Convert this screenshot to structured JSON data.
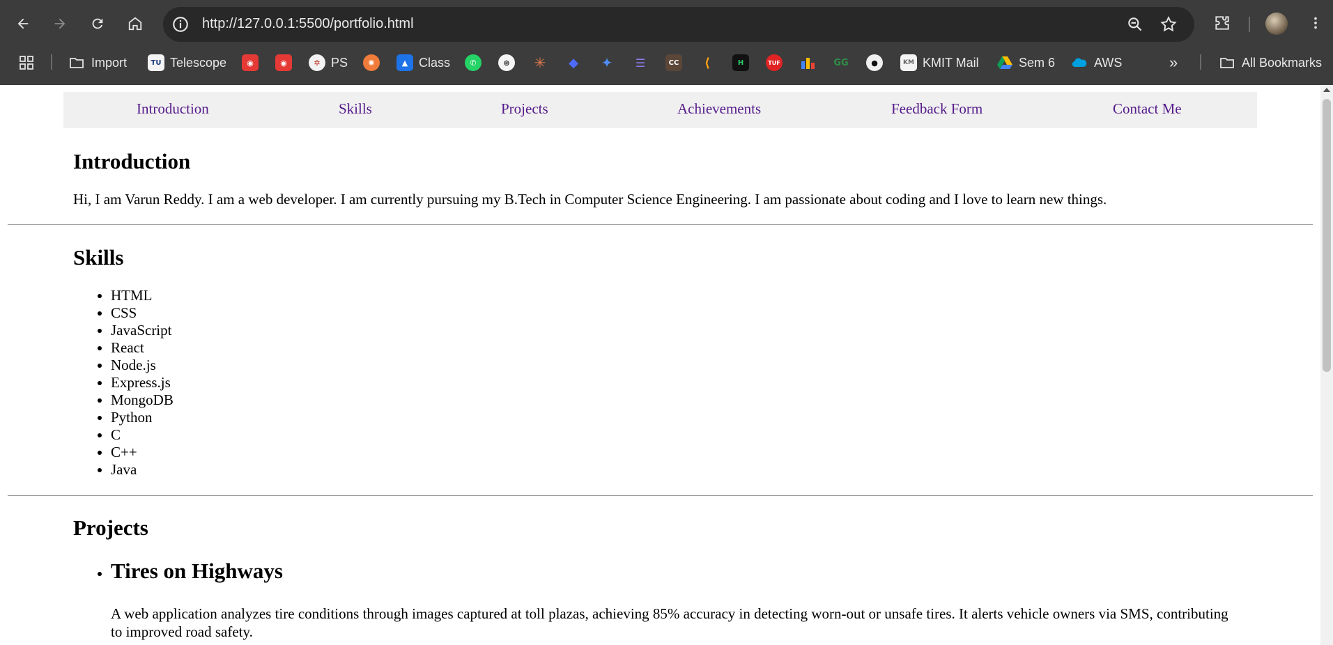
{
  "browser": {
    "url": "http://127.0.0.1:5500/portfolio.html",
    "bookmarks": [
      {
        "label": "Import",
        "icon": "folder-icon"
      },
      {
        "label": "Telescope",
        "icon": "telescope-icon"
      },
      {
        "label": "",
        "icon": "red-eye-icon"
      },
      {
        "label": "",
        "icon": "red-eye-icon"
      },
      {
        "label": "PS",
        "icon": "ps-icon"
      },
      {
        "label": "",
        "icon": "orange-brain-icon"
      },
      {
        "label": "Class",
        "icon": "classroom-icon"
      },
      {
        "label": "",
        "icon": "whatsapp-icon"
      },
      {
        "label": "",
        "icon": "chatgpt-icon"
      },
      {
        "label": "",
        "icon": "claude-icon"
      },
      {
        "label": "",
        "icon": "deepseek-icon"
      },
      {
        "label": "",
        "icon": "gemini-icon"
      },
      {
        "label": "",
        "icon": "gemini-code-icon"
      },
      {
        "label": "",
        "icon": "codechef-icon"
      },
      {
        "label": "",
        "icon": "leetcode-icon"
      },
      {
        "label": "",
        "icon": "hackerrank-icon"
      },
      {
        "label": "",
        "icon": "tuf-icon"
      },
      {
        "label": "",
        "icon": "bar-chart-icon"
      },
      {
        "label": "",
        "icon": "geeksforgeeks-icon"
      },
      {
        "label": "",
        "icon": "github-icon"
      },
      {
        "label": "KMIT Mail",
        "icon": "kmit-icon"
      },
      {
        "label": "Sem 6",
        "icon": "drive-icon"
      },
      {
        "label": "AWS",
        "icon": "salesforce-cloud-icon"
      }
    ],
    "all_bookmarks_label": "All Bookmarks",
    "colors": {
      "chrome": "#3c3c3c",
      "omnibox": "#282828",
      "link": "#551a8b"
    }
  },
  "page": {
    "nav": [
      "Introduction",
      "Skills",
      "Projects",
      "Achievements",
      "Feedback Form",
      "Contact Me"
    ],
    "intro": {
      "heading": "Introduction",
      "text": "Hi, I am Varun Reddy. I am a web developer. I am currently pursuing my B.Tech in Computer Science Engineering. I am passionate about coding and I love to learn new things."
    },
    "skills": {
      "heading": "Skills",
      "items": [
        "HTML",
        "CSS",
        "JavaScript",
        "React",
        "Node.js",
        "Express.js",
        "MongoDB",
        "Python",
        "C",
        "C++",
        "Java"
      ]
    },
    "projects": {
      "heading": "Projects",
      "items": [
        {
          "title": "Tires on Highways",
          "description": "A web application analyzes tire conditions through images captured at toll plazas, achieving 85% accuracy in detecting worn-out or unsafe tires. It alerts vehicle owners via SMS, contributing to improved road safety."
        }
      ]
    }
  }
}
